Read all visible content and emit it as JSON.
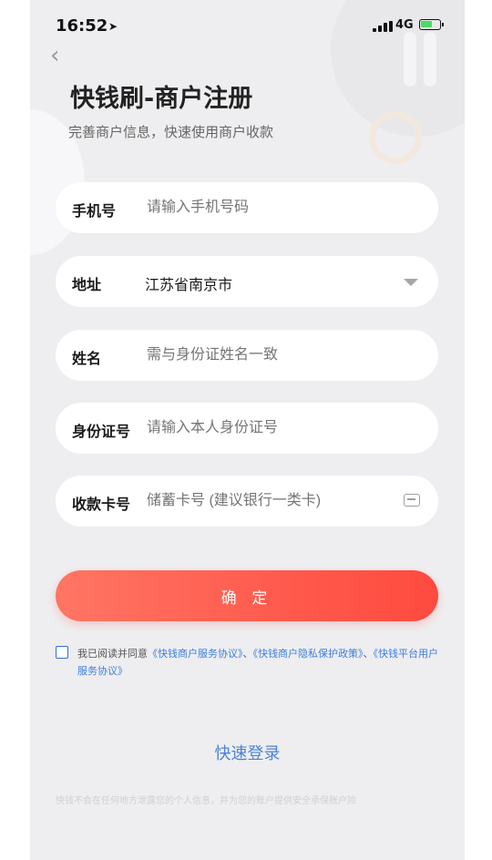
{
  "status_bar": {
    "time": "16:52",
    "network": "4G",
    "location_icon": "location-arrow-icon",
    "signal_icon": "signal-bars-icon",
    "battery_icon": "battery-charging-icon"
  },
  "nav": {
    "back_icon": "chevron-left-icon"
  },
  "header": {
    "title": "快钱刷-商户注册",
    "subtitle": "完善商户信息，快速使用商户收款"
  },
  "form": {
    "phone": {
      "label": "手机号",
      "placeholder": "请输入手机号码",
      "value": ""
    },
    "address": {
      "label": "地址",
      "value": "江苏省南京市",
      "icon": "dropdown-triangle-icon"
    },
    "name": {
      "label": "姓名",
      "placeholder": "需与身份证姓名一致",
      "value": ""
    },
    "id_number": {
      "label": "身份证号",
      "placeholder": "请输入本人身份证号",
      "value": ""
    },
    "card_number": {
      "label": "收款卡号",
      "placeholder": "储蓄卡号 (建议银行一类卡)",
      "value": "",
      "icon": "card-scan-icon"
    }
  },
  "confirm_button": {
    "label": "确 定"
  },
  "agreement": {
    "checked": false,
    "prefix": "我已阅读并同意",
    "link1": "《快钱商户服务协议》",
    "sep1": "、",
    "link2": "《快钱商户隐私保护政策》",
    "sep2": "、",
    "link3": "《快钱平台用户服务协议》"
  },
  "quick_login": {
    "label": "快速登录"
  },
  "footer": {
    "text": "快钱不会在任何地方泄露您的个人信息，并为您的账户提供安全承保账户险"
  },
  "colors": {
    "accent": "#ff5a4d",
    "link": "#3c7de0",
    "background": "#eeeef0"
  }
}
